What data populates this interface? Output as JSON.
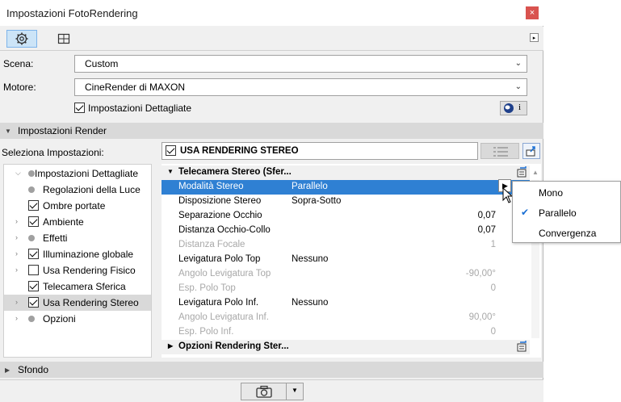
{
  "window": {
    "title": "Impostazioni FotoRendering",
    "close_label": "×"
  },
  "toolbar": {
    "collapse_icon": "▸"
  },
  "scene": {
    "label": "Scena:",
    "value": "Custom"
  },
  "engine": {
    "label": "Motore:",
    "value": "CineRender di MAXON"
  },
  "detailed": {
    "label": "Impostazioni Dettagliate",
    "checked": true,
    "info_label": "i"
  },
  "render_section": {
    "label": "Impostazioni Render"
  },
  "select_settings": {
    "label": "Seleziona Impostazioni:",
    "header_label": "USA RENDERING STEREO"
  },
  "tree": [
    {
      "label": "Impostazioni Dettagliate",
      "kind": "dot",
      "expander": "open"
    },
    {
      "label": "Regolazioni della Luce",
      "kind": "dot",
      "expander": "none"
    },
    {
      "label": "Ombre portate",
      "kind": "check",
      "checked": true,
      "expander": "none"
    },
    {
      "label": "Ambiente",
      "kind": "check",
      "checked": true,
      "expander": "closed"
    },
    {
      "label": "Effetti",
      "kind": "dot",
      "expander": "closed"
    },
    {
      "label": "Illuminazione globale",
      "kind": "check",
      "checked": true,
      "expander": "closed"
    },
    {
      "label": "Usa Rendering Fisico",
      "kind": "check",
      "checked": false,
      "expander": "closed"
    },
    {
      "label": "Telecamera Sferica",
      "kind": "check",
      "checked": true,
      "expander": "none"
    },
    {
      "label": "Usa Rendering Stereo",
      "kind": "check",
      "checked": true,
      "expander": "closed",
      "selected": true
    },
    {
      "label": "Opzioni",
      "kind": "dot",
      "expander": "closed"
    }
  ],
  "properties": {
    "group1": "Telecamera Stereo (Sfer...",
    "rows": [
      {
        "name": "Modalità Stereo",
        "value": "Parallelo",
        "number": "",
        "state": "selected"
      },
      {
        "name": "Disposizione Stereo",
        "value": "Sopra-Sotto",
        "number": "",
        "state": "normal"
      },
      {
        "name": "Separazione Occhio",
        "value": "",
        "number": "0,07",
        "state": "normal"
      },
      {
        "name": "Distanza Occhio-Collo",
        "value": "",
        "number": "0,07",
        "state": "normal"
      },
      {
        "name": "Distanza Focale",
        "value": "",
        "number": "1",
        "state": "disabled"
      },
      {
        "name": "Levigatura Polo Top",
        "value": "Nessuno",
        "number": "",
        "state": "normal"
      },
      {
        "name": "Angolo Levigatura Top",
        "value": "",
        "number": "-90,00°",
        "state": "disabled"
      },
      {
        "name": "Esp. Polo Top",
        "value": "",
        "number": "0",
        "state": "disabled"
      },
      {
        "name": "Levigatura Polo Inf.",
        "value": "Nessuno",
        "number": "",
        "state": "normal"
      },
      {
        "name": "Angolo Levigatura Inf.",
        "value": "",
        "number": "90,00°",
        "state": "disabled"
      },
      {
        "name": "Esp. Polo Inf.",
        "value": "",
        "number": "0",
        "state": "disabled"
      }
    ],
    "group2": "Opzioni Rendering Ster..."
  },
  "popup": {
    "options": [
      {
        "label": "Mono",
        "selected": false
      },
      {
        "label": "Parallelo",
        "selected": true
      },
      {
        "label": "Convergenza",
        "selected": false
      }
    ],
    "check_mark": "✔"
  },
  "background_section": {
    "label": "Sfondo"
  },
  "colors": {
    "selection": "#2f80d3",
    "accent": "#1a6fd4",
    "close": "#d9534f"
  }
}
